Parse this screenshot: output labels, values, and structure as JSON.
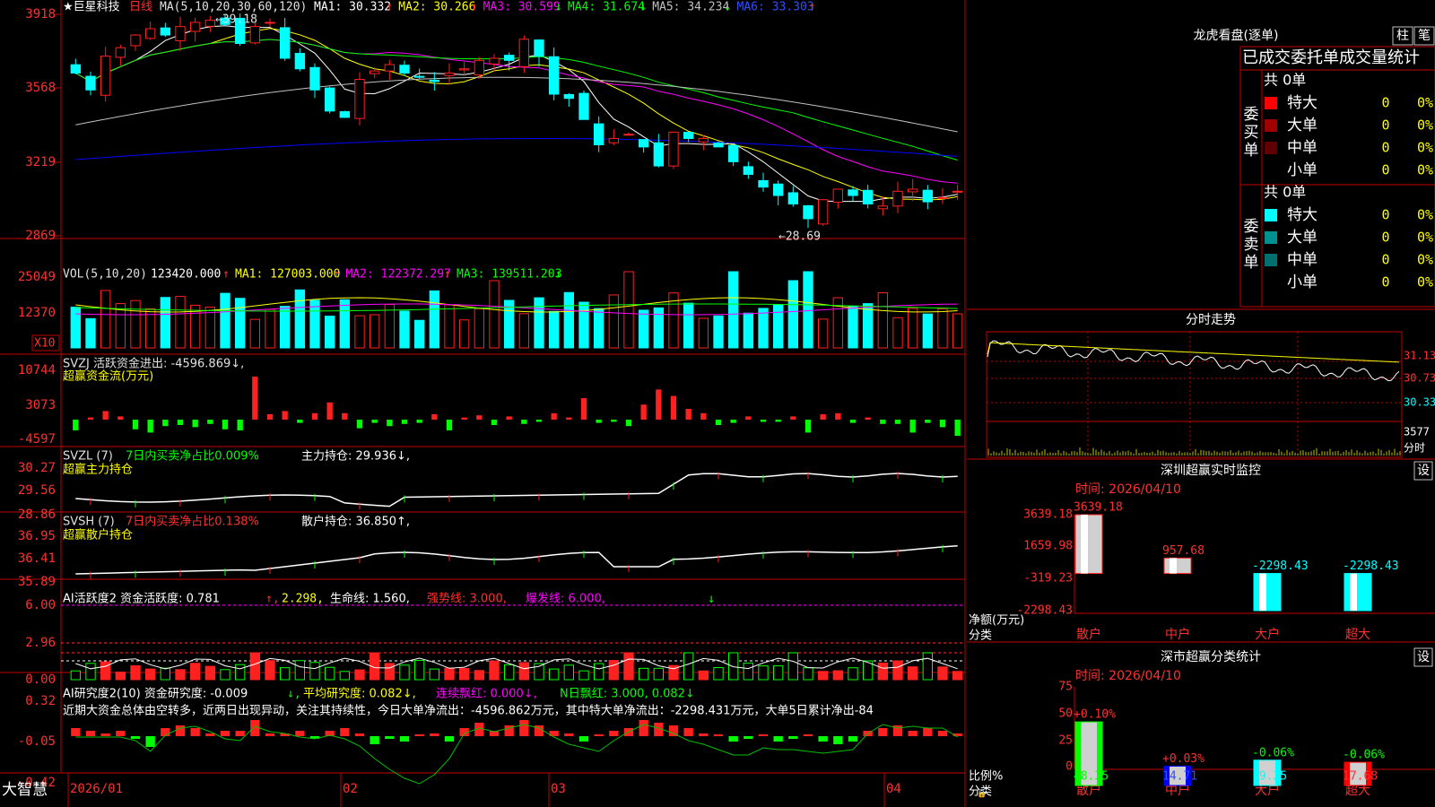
{
  "brand": "大智慧",
  "stock": {
    "name": "巨星科技",
    "period": "日线",
    "star": "★"
  },
  "colors": {
    "up": "#ff2020",
    "down": "#00ffff",
    "grid": "#c00000",
    "ma1": "#ffffff",
    "ma2": "#ffff00",
    "ma3": "#ff00ff",
    "ma4": "#00ff00",
    "ma5": "#c0c0c0",
    "ma6": "#0000ff"
  },
  "kline": {
    "ma_header": "MA(5,10,20,30,60,120)",
    "ma_values": [
      {
        "label": "MA1:",
        "value": "30.332",
        "arrow": "↑",
        "color": "#ffffff"
      },
      {
        "label": "MA2:",
        "value": "30.266",
        "arrow": "↑",
        "color": "#ffff00"
      },
      {
        "label": "MA3:",
        "value": "30.599",
        "arrow": "↓",
        "color": "#ff00ff"
      },
      {
        "label": "MA4:",
        "value": "31.674",
        "arrow": "↓",
        "color": "#00ff00"
      },
      {
        "label": "MA5:",
        "value": "34.234",
        "arrow": "↓",
        "color": "#c0c0c0"
      },
      {
        "label": "MA6:",
        "value": "33.303",
        "arrow": "↑",
        "color": "#0000ff"
      }
    ],
    "y_ticks": [
      "3918",
      "3568",
      "3219",
      "2869"
    ],
    "high_label": "39.18",
    "low_label": "28.69"
  },
  "volume": {
    "header": "VOL(5,10,20)",
    "value": "123420.000",
    "ma": [
      {
        "label": "MA1:",
        "value": "127003.000",
        "arrow": "↑",
        "color": "#ffff00"
      },
      {
        "label": "MA2:",
        "value": "122372.297",
        "arrow": "↑",
        "color": "#ff00ff"
      },
      {
        "label": "MA3:",
        "value": "139511.203",
        "arrow": "↓",
        "color": "#00ff00"
      }
    ],
    "y_ticks": [
      "25049",
      "12370"
    ],
    "unit": "X10"
  },
  "svzj": {
    "title": "SVZJ",
    "label": "活跃资金进出:",
    "value": "-4596.869",
    "arrow": "↓",
    "subtitle": "超赢资金流(万元)",
    "y_ticks": [
      "10744",
      "3073",
      "-4597"
    ]
  },
  "svzl": {
    "title": "SVZL (7)",
    "ratio": "7日内买卖净占比0.009%",
    "label": "主力持仓:",
    "value": "29.936",
    "arrow": "↓",
    "subtitle": "超赢主力持仓",
    "y_ticks": [
      "30.27",
      "29.56",
      "28.86"
    ]
  },
  "svsh": {
    "title": "SVSH (7)",
    "ratio": "7日内买卖净占比0.138%",
    "label": "散户持仓:",
    "value": "36.850",
    "arrow": "↑",
    "subtitle": "超赢散户持仓",
    "y_ticks": [
      "36.95",
      "36.41",
      "35.89"
    ]
  },
  "ai_active": {
    "title": "AI活跃度2",
    "label": "资金活跃度:",
    "value": "0.781",
    "arrow": "↑",
    "v2": "2.298",
    "life_label": "生命线:",
    "life": "1.560",
    "strong": "强势线: 3.000",
    "burst": "爆发线: 6.000",
    "y_ticks": [
      "6.00",
      "2.96",
      "0.00"
    ]
  },
  "ai_research": {
    "title": "AI研究度2(10)",
    "label": "资金研究度:",
    "value": "-0.009",
    "arrow": "↓",
    "avg": "平均研究度: 0.082",
    "streak": "连续飘红: 0.000",
    "nday": "N日飘红: 3.000, 0.082",
    "comment": "近期大资金总体由空转多，近两日出现异动，关注其持续性，今日大单净流出：-4596.862万元，其中特大单净流出：-2298.431万元，大单5日累计净出-84",
    "y_ticks": [
      "0.32",
      "-0.05",
      "-0.42"
    ]
  },
  "x_axis": {
    "labels": [
      "2026/01",
      "02",
      "03",
      "04"
    ]
  },
  "longhu": {
    "title": "龙虎看盘(逐单)",
    "btn1": "柱",
    "btn2": "笔",
    "header": "已成交委托单成交量统计",
    "buy": {
      "side": "委买单",
      "total": "共 0单",
      "rows": [
        {
          "name": "特大",
          "count": "0",
          "pct": "0%",
          "color": "#ff0000"
        },
        {
          "name": "大单",
          "count": "0",
          "pct": "0%",
          "color": "#a00000"
        },
        {
          "name": "中单",
          "count": "0",
          "pct": "0%",
          "color": "#600000"
        },
        {
          "name": "小单",
          "count": "0",
          "pct": "0%",
          "color": ""
        }
      ]
    },
    "sell": {
      "side": "委卖单",
      "total": "共 0单",
      "rows": [
        {
          "name": "特大",
          "count": "0",
          "pct": "0%",
          "color": "#00ffff"
        },
        {
          "name": "大单",
          "count": "0",
          "pct": "0%",
          "color": "#009090"
        },
        {
          "name": "中单",
          "count": "0",
          "pct": "0%",
          "color": "#007070"
        },
        {
          "name": "小单",
          "count": "0",
          "pct": "0%",
          "color": ""
        }
      ]
    }
  },
  "intraday": {
    "title": "分时走势",
    "price_ticks": [
      "31.13",
      "30.73",
      "30.33"
    ],
    "vol_tick": "3577",
    "vol_label": "分时"
  },
  "monitor": {
    "title": "深圳超赢实时监控",
    "btn": "设",
    "time": "时间: 2026/04/10",
    "y_ticks": [
      "3639.18",
      "1659.98",
      "-319.23",
      "-2298.43"
    ],
    "ylabel": "净额(万元)",
    "xlabel": "分类",
    "categories": [
      "散户",
      "中户",
      "大户",
      "超大"
    ],
    "values": [
      3639.18,
      957.68,
      -2298.43,
      -2298.43
    ],
    "value_labels": [
      "3639.18",
      "957.68",
      "-2298.43",
      "-2298.43"
    ]
  },
  "classify": {
    "title": "深市超赢分类统计",
    "btn": "设",
    "time": "时间: 2026/04/10",
    "y_ticks": [
      "75",
      "50",
      "25",
      "0"
    ],
    "ylabel": "比例%",
    "xlabel": "分类",
    "categories": [
      "散户",
      "中户",
      "大户",
      "超大"
    ],
    "values": [
      48.35,
      14.71,
      19.25,
      17.68
    ],
    "value_labels": [
      "48.35",
      "14.71",
      "19.25",
      "17.68"
    ],
    "change_labels": [
      "+0.10%",
      "+0.03%",
      "-0.06%",
      "-0.06%"
    ]
  },
  "chart_data": [
    {
      "type": "bar",
      "title": "深圳超赢实时监控",
      "categories": [
        "散户",
        "中户",
        "大户",
        "超大"
      ],
      "values": [
        3639.18,
        957.68,
        -2298.43,
        -2298.43
      ],
      "ylabel": "净额(万元)",
      "xlabel": "分类",
      "ylim": [
        -2298.43,
        3639.18
      ]
    },
    {
      "type": "bar",
      "title": "深市超赢分类统计",
      "categories": [
        "散户",
        "中户",
        "大户",
        "超大"
      ],
      "values": [
        48.35,
        14.71,
        19.25,
        17.68
      ],
      "ylabel": "比例%",
      "xlabel": "分类",
      "ylim": [
        0,
        75
      ]
    }
  ]
}
